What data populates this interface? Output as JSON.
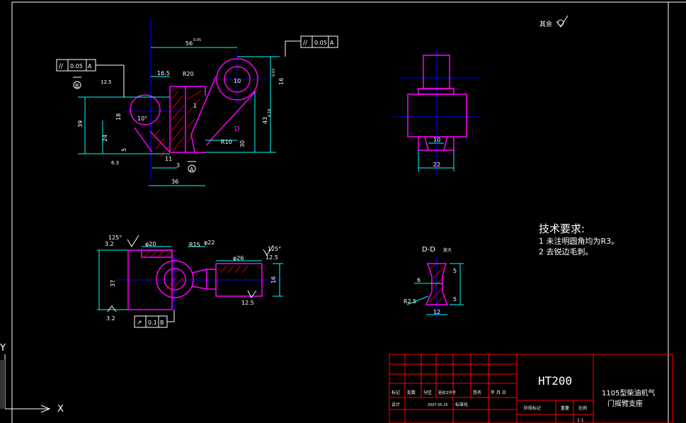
{
  "material": "HT200",
  "title_block": {
    "part_name_line1": "1105型柴油机气",
    "part_name_line2": "门摇臂支座",
    "row_labels_1": [
      "标记",
      "处数",
      "分区",
      "更改文件号",
      "签名",
      "年 月 日"
    ],
    "row_labels_2": [
      "设计",
      "2007.05.25",
      "标准化"
    ],
    "stage_label": "阶段标记",
    "weight_label": "重量",
    "scale_label": "比例",
    "scale_value": "1:1"
  },
  "roughness_note": "其余",
  "tech_requirements": {
    "title": "技术要求:",
    "items": [
      "1 未注明圆角均为R3。",
      "2 去锐边毛刺。"
    ]
  },
  "section_label": "D-D",
  "section_note": "放大",
  "tolerance_frames": {
    "top_left": {
      "symbol": "//",
      "value": "0.05",
      "datum": "A"
    },
    "top_right": {
      "symbol": "//",
      "value": "0.05",
      "datum": "A"
    },
    "bottom": {
      "symbol": "↗",
      "value": "0.1",
      "datum": "B"
    }
  },
  "datum_labels": [
    "B",
    "A",
    "A",
    "B"
  ],
  "dims_front": {
    "d56": "56",
    "d56_tol": "0.05",
    "d16_5": "16.5",
    "r20": "R20",
    "r10": "R10",
    "d36": "36",
    "d39": "39",
    "d24": "24",
    "d5": "5",
    "d11": "11",
    "d3": "3",
    "d16": "16",
    "d43": "43",
    "d30": "30",
    "d10": "10",
    "d18": "18",
    "angle10": "10°",
    "d12_5": "12.5",
    "d6_3": "6.3",
    "d1": "1",
    "label_D": "D",
    "small_tol_a": "0.03",
    "small_tol_b": "0.18"
  },
  "dims_side": {
    "d10": "10",
    "d22": "22"
  },
  "dims_top": {
    "r15": "R15",
    "phi22": "φ22",
    "phi26": "φ26",
    "phi20": "φ20",
    "d37": "37",
    "d16": "16",
    "d3_2a": "3.2",
    "d3_2b": "3.2",
    "d12_5": "12.5",
    "ang125a": "125°",
    "ang125b": "125°",
    "d12_5b": "12.5"
  },
  "dims_section": {
    "d6": "6",
    "d5a": "5",
    "d5b": "5",
    "d12": "12",
    "r2_5": "R2.5"
  },
  "ucs": {
    "x": "X",
    "y": "Y"
  },
  "colors": {
    "border": "#ffffff",
    "part": "#ff00ff",
    "dim": "#00ffff",
    "text": "#ffffff",
    "title_grid": "#ff0000",
    "center": "#0000ff",
    "hatch": "#ff0000"
  }
}
